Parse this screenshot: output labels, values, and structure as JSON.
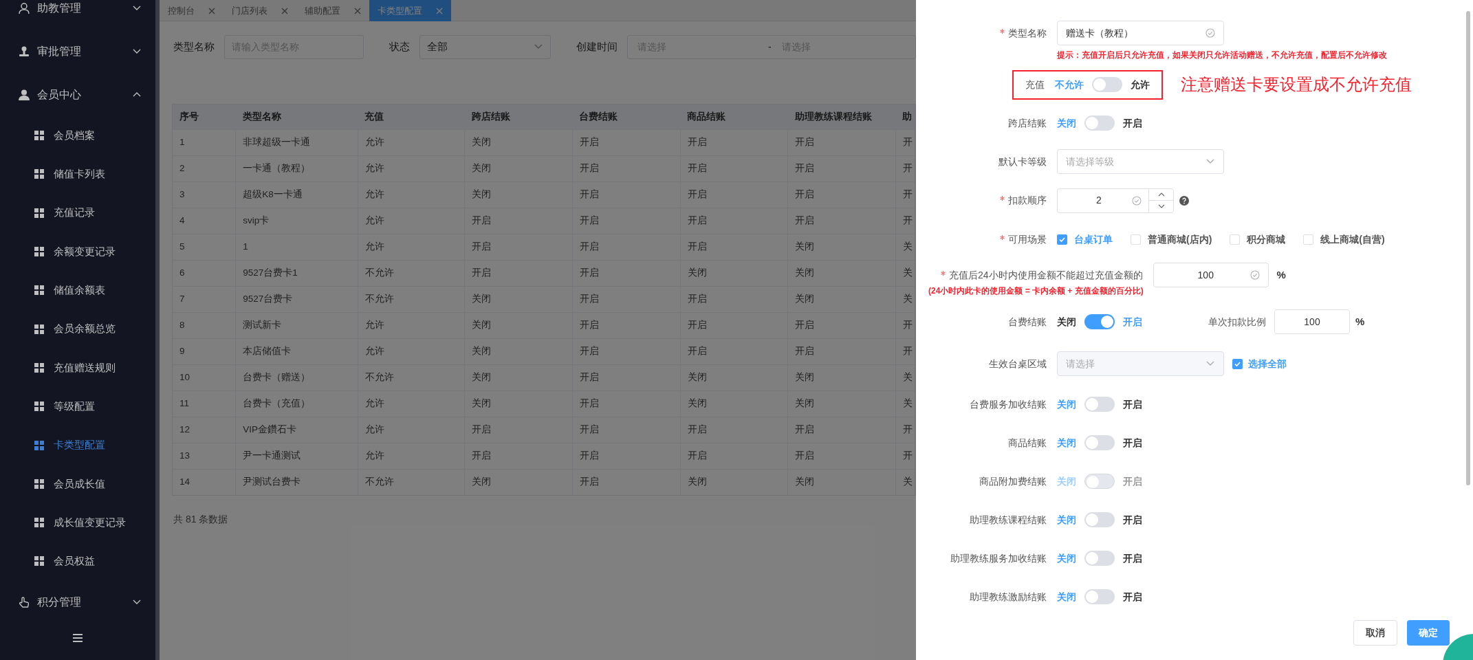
{
  "sidebar": {
    "items": [
      {
        "label": "助教管理",
        "expanded": false
      },
      {
        "label": "审批管理",
        "expanded": false
      },
      {
        "label": "会员中心",
        "expanded": true,
        "children": [
          {
            "label": "会员档案",
            "selected": false
          },
          {
            "label": "储值卡列表",
            "selected": false
          },
          {
            "label": "充值记录",
            "selected": false
          },
          {
            "label": "余额变更记录",
            "selected": false
          },
          {
            "label": "储值余额表",
            "selected": false
          },
          {
            "label": "会员余额总览",
            "selected": false
          },
          {
            "label": "充值赠送规则",
            "selected": false
          },
          {
            "label": "等级配置",
            "selected": false
          },
          {
            "label": "卡类型配置",
            "selected": true
          },
          {
            "label": "会员成长值",
            "selected": false
          },
          {
            "label": "成长值变更记录",
            "selected": false
          },
          {
            "label": "会员权益",
            "selected": false
          }
        ]
      },
      {
        "label": "积分管理",
        "expanded": false
      }
    ]
  },
  "tabs": [
    {
      "label": "控制台",
      "selected": false
    },
    {
      "label": "门店列表",
      "selected": false
    },
    {
      "label": "辅助配置",
      "selected": false
    },
    {
      "label": "卡类型配置",
      "selected": true
    }
  ],
  "filters": {
    "name": {
      "label": "类型名称",
      "placeholder": "请输入类型名称"
    },
    "status": {
      "label": "状态",
      "value": "全部"
    },
    "created": {
      "label": "创建时间",
      "start_placeholder": "请选择",
      "separator": "-",
      "end_placeholder": "请选择"
    }
  },
  "table": {
    "columns": [
      "序号",
      "类型名称",
      "充值",
      "跨店结账",
      "台费结账",
      "商品结账",
      "助理教练课程结账",
      "助"
    ],
    "rows": [
      [
        "1",
        "非球超级一卡通",
        "允许",
        "关闭",
        "开启",
        "开启",
        "开启",
        "开"
      ],
      [
        "2",
        "一卡通（教程）",
        "允许",
        "关闭",
        "开启",
        "开启",
        "开启",
        "开"
      ],
      [
        "3",
        "超级K8一卡通",
        "允许",
        "关闭",
        "开启",
        "开启",
        "开启",
        "开"
      ],
      [
        "4",
        "svip卡",
        "允许",
        "开启",
        "开启",
        "开启",
        "开启",
        "开"
      ],
      [
        "5",
        "1",
        "允许",
        "开启",
        "开启",
        "开启",
        "关闭",
        "关"
      ],
      [
        "6",
        "9527台费卡1",
        "不允许",
        "开启",
        "开启",
        "关闭",
        "关闭",
        "关"
      ],
      [
        "7",
        "9527台费卡",
        "不允许",
        "关闭",
        "开启",
        "开启",
        "关闭",
        "关"
      ],
      [
        "8",
        "测试新卡",
        "允许",
        "关闭",
        "开启",
        "开启",
        "开启",
        "开"
      ],
      [
        "9",
        "本店储值卡",
        "允许",
        "关闭",
        "开启",
        "开启",
        "开启",
        "开"
      ],
      [
        "10",
        "台费卡（赠送）",
        "不允许",
        "关闭",
        "开启",
        "关闭",
        "关闭",
        "关"
      ],
      [
        "11",
        "台费卡（充值）",
        "允许",
        "关闭",
        "开启",
        "关闭",
        "关闭",
        "关"
      ],
      [
        "12",
        "VIP金鑽石卡",
        "允许",
        "开启",
        "开启",
        "开启",
        "开启",
        "开"
      ],
      [
        "13",
        "尹一卡通测试",
        "允许",
        "开启",
        "开启",
        "开启",
        "开启",
        "开"
      ],
      [
        "14",
        "尹测试台费卡",
        "不允许",
        "关闭",
        "开启",
        "关闭",
        "关闭",
        "关"
      ]
    ],
    "total": "共 81 条数据"
  },
  "form": {
    "fields": [
      {
        "kind": "input",
        "label": "类型名称",
        "required": true,
        "value": "赠送卡（教程）",
        "hint": "提示：充值开启后只允许充值，如果关闭只允许活动赠送，不允许充值，配置后不允许修改"
      },
      {
        "kind": "switch",
        "label": "充值",
        "off_label": "不允许",
        "on_label": "允许",
        "on": false,
        "highlighted": true,
        "annotation": "注意赠送卡要设置成不允许充值"
      },
      {
        "kind": "switch",
        "label": "跨店结账",
        "off_label": "关闭",
        "on_label": "开启",
        "on": false
      },
      {
        "kind": "select",
        "label": "默认卡等级",
        "placeholder": "请选择等级"
      },
      {
        "kind": "number",
        "label": "扣款顺序",
        "required": true,
        "value": "2"
      },
      {
        "kind": "checkboxes",
        "label": "可用场景",
        "required": true,
        "options": [
          {
            "label": "台桌订单",
            "checked": true
          },
          {
            "label": "普通商城(店内)",
            "checked": false
          },
          {
            "label": "积分商城",
            "checked": false
          },
          {
            "label": "线上商城(自营)",
            "checked": false
          }
        ]
      },
      {
        "kind": "percent",
        "label": "充值后24小时内使用金额不能超过充值金额的",
        "required": true,
        "value": "100",
        "unit": "%",
        "note": "(24小时内此卡的使用金额 = 卡内余额 + 充值金额的百分比)"
      },
      {
        "kind": "switch",
        "label": "台费结账",
        "off_label": "关闭",
        "on_label": "开启",
        "on": true,
        "extra": {
          "label": "单次扣款比例",
          "value": "100",
          "unit": "%"
        }
      },
      {
        "kind": "select",
        "label": "生效台桌区域",
        "placeholder": "请选择",
        "disabled": true,
        "checkbox": {
          "label": "选择全部",
          "checked": true
        }
      },
      {
        "kind": "switch",
        "label": "台费服务加收结账",
        "off_label": "关闭",
        "on_label": "开启",
        "on": false
      },
      {
        "kind": "switch",
        "label": "商品结账",
        "off_label": "关闭",
        "on_label": "开启",
        "on": false
      },
      {
        "kind": "switch",
        "label": "商品附加费结账",
        "off_label": "关闭",
        "on_label": "开启",
        "on": false,
        "disabled": true
      },
      {
        "kind": "switch",
        "label": "助理教练课程结账",
        "off_label": "关闭",
        "on_label": "开启",
        "on": false
      },
      {
        "kind": "switch",
        "label": "助理教练服务加收结账",
        "off_label": "关闭",
        "on_label": "开启",
        "on": false
      },
      {
        "kind": "switch",
        "label": "助理教练激励结账",
        "off_label": "关闭",
        "on_label": "开启",
        "on": false
      }
    ],
    "buttons": [
      {
        "label": "取消",
        "primary": false
      },
      {
        "label": "确定",
        "primary": true
      }
    ]
  }
}
